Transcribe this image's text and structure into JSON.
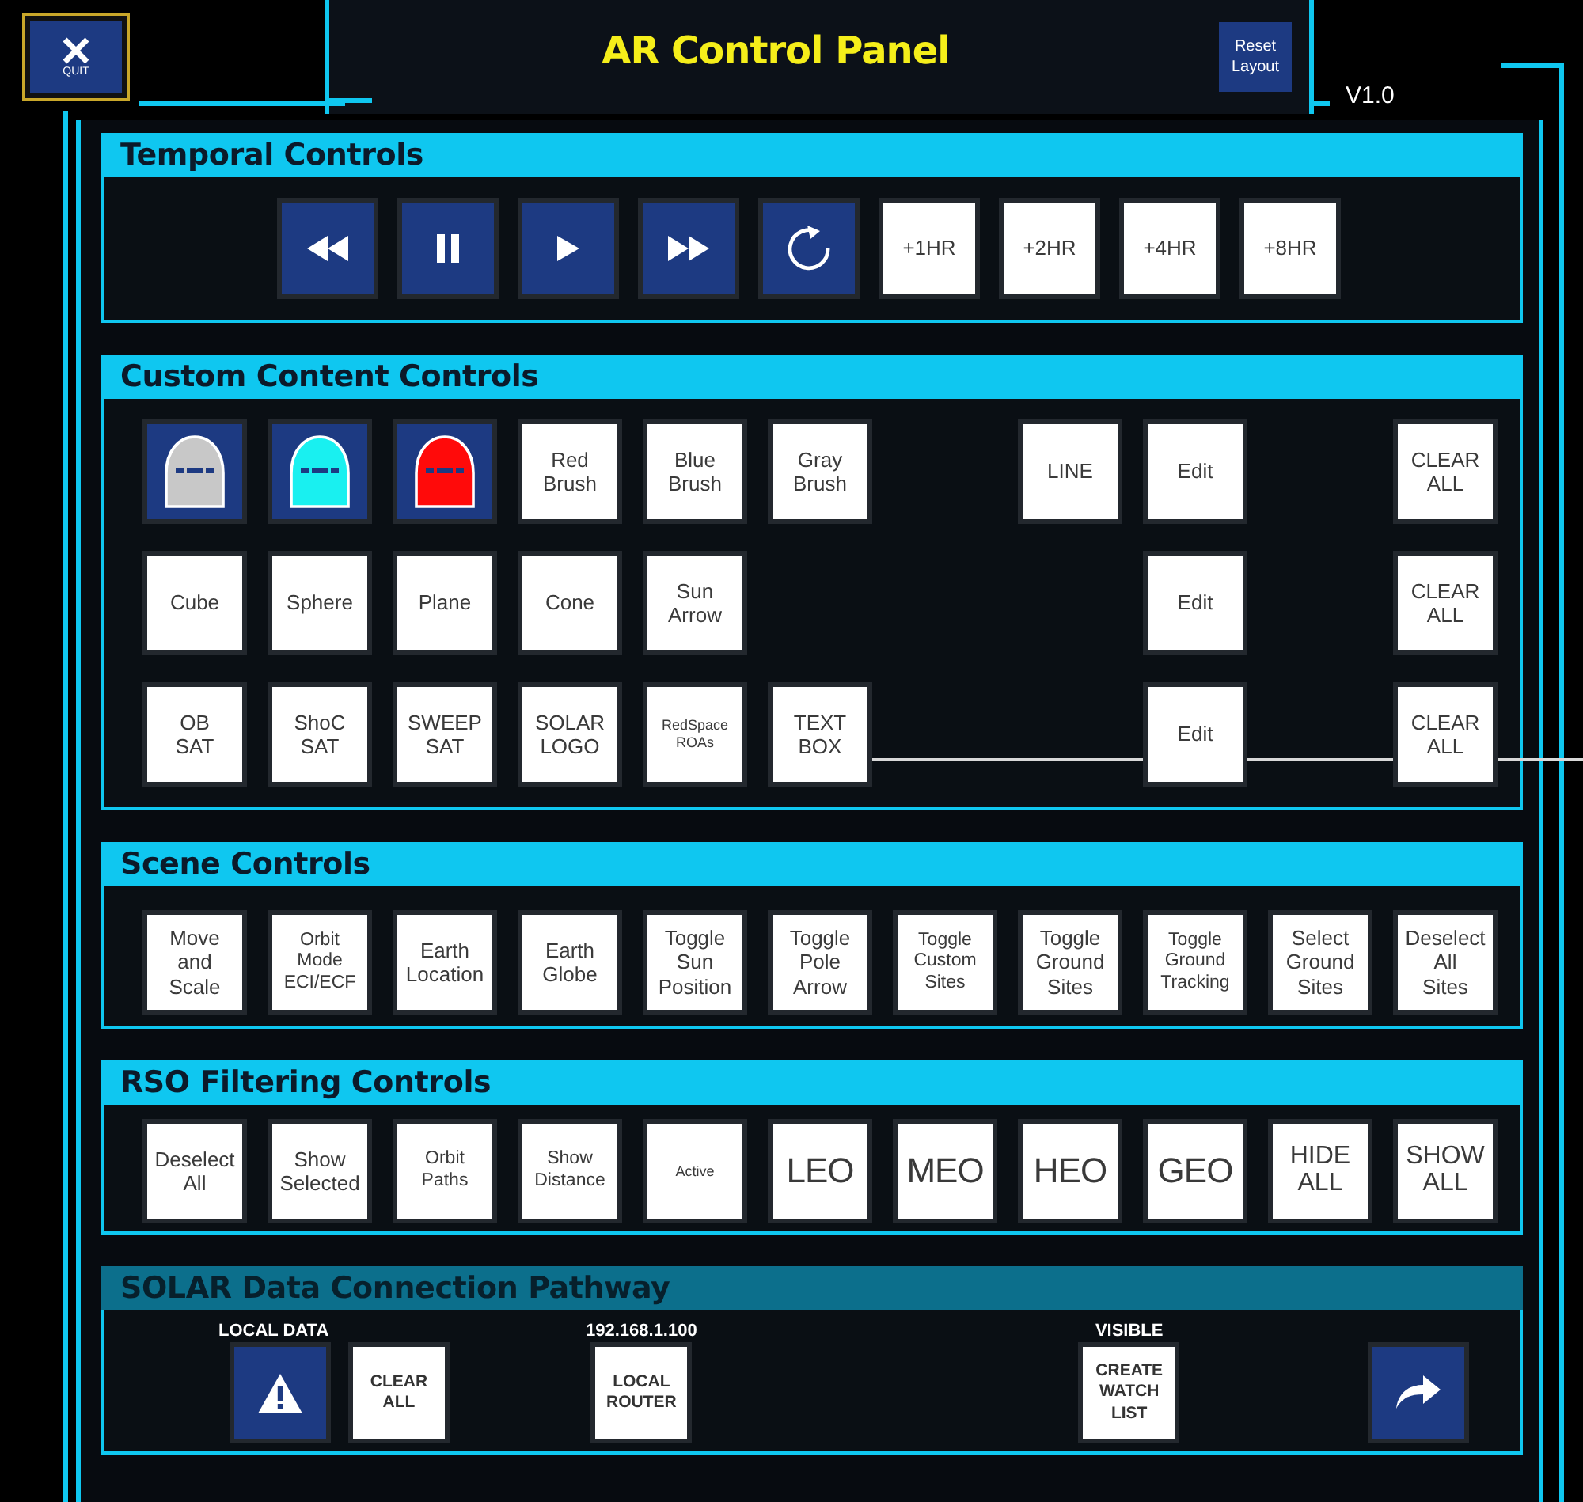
{
  "header": {
    "quit_label": "QUIT",
    "title": "AR Control Panel",
    "reset_label": "Reset\nLayout",
    "version": "V1.0"
  },
  "temporal": {
    "title": "Temporal Controls",
    "buttons": [
      {
        "kind": "rewind"
      },
      {
        "kind": "pause"
      },
      {
        "kind": "play"
      },
      {
        "kind": "forward"
      },
      {
        "kind": "replay"
      },
      {
        "kind": "text",
        "label": "+1HR"
      },
      {
        "kind": "text",
        "label": "+2HR"
      },
      {
        "kind": "text",
        "label": "+4HR"
      },
      {
        "kind": "text",
        "label": "+8HR"
      }
    ]
  },
  "custom_content": {
    "title": "Custom Content Controls",
    "rows": [
      {
        "items": [
          {
            "kind": "brush",
            "color": "#c8c8c8"
          },
          {
            "kind": "brush",
            "color": "#19f0f0"
          },
          {
            "kind": "brush",
            "color": "#ff0a0a"
          },
          {
            "kind": "text",
            "label": "Red\nBrush"
          },
          {
            "kind": "text",
            "label": "Blue\nBrush"
          },
          {
            "kind": "text",
            "label": "Gray\nBrush"
          }
        ],
        "line": "LINE",
        "edit": "Edit",
        "clear": "CLEAR\nALL"
      },
      {
        "items": [
          {
            "kind": "text",
            "label": "Cube"
          },
          {
            "kind": "text",
            "label": "Sphere"
          },
          {
            "kind": "text",
            "label": "Plane"
          },
          {
            "kind": "text",
            "label": "Cone"
          },
          {
            "kind": "text",
            "label": "Sun\nArrow"
          }
        ],
        "edit": "Edit",
        "clear": "CLEAR\nALL"
      },
      {
        "items": [
          {
            "kind": "text",
            "label": "OB\nSAT"
          },
          {
            "kind": "text",
            "label": "ShoC\nSAT"
          },
          {
            "kind": "text",
            "label": "SWEEP\nSAT"
          },
          {
            "kind": "text",
            "label": "SOLAR\nLOGO"
          },
          {
            "kind": "tiny",
            "label": "RedSpace\nROAs"
          },
          {
            "kind": "text",
            "label": "TEXT\nBOX"
          }
        ],
        "edit": "Edit",
        "clear": "CLEAR\nALL"
      }
    ]
  },
  "scene": {
    "title": "Scene Controls",
    "buttons": [
      {
        "kind": "text",
        "label": "Move\nand\nScale"
      },
      {
        "kind": "small",
        "label": "Orbit\nMode\nECI/ECF"
      },
      {
        "kind": "text",
        "label": "Earth\nLocation"
      },
      {
        "kind": "text",
        "label": "Earth\nGlobe"
      },
      {
        "kind": "text",
        "label": "Toggle\nSun\nPosition"
      },
      {
        "kind": "text",
        "label": "Toggle\nPole\nArrow"
      },
      {
        "kind": "small",
        "label": "Toggle\nCustom\nSites"
      },
      {
        "kind": "text",
        "label": "Toggle\nGround\nSites"
      },
      {
        "kind": "small",
        "label": "Toggle\nGround\nTracking"
      },
      {
        "kind": "text",
        "label": "Select\nGround\nSites"
      },
      {
        "kind": "text",
        "label": "Deselect\nAll\nSites"
      }
    ]
  },
  "rso_filtering": {
    "title": "RSO Filtering Controls",
    "buttons": [
      {
        "kind": "text",
        "label": "Deselect\nAll"
      },
      {
        "kind": "text",
        "label": "Show\nSelected"
      },
      {
        "kind": "small",
        "label": "Orbit\nPaths"
      },
      {
        "kind": "small",
        "label": "Show\nDistance"
      },
      {
        "kind": "tiny",
        "label": "Active"
      },
      {
        "kind": "big",
        "label": "LEO"
      },
      {
        "kind": "big",
        "label": "MEO"
      },
      {
        "kind": "big",
        "label": "HEO"
      },
      {
        "kind": "big",
        "label": "GEO"
      },
      {
        "kind": "medium",
        "label": "HIDE\nALL"
      },
      {
        "kind": "medium",
        "label": "SHOW\nALL"
      }
    ]
  },
  "solar_pathway": {
    "title": "SOLAR Data Connection Pathway",
    "groups": [
      {
        "caption": "LOCAL DATA",
        "buttons": [
          {
            "kind": "warning"
          },
          {
            "kind": "bold",
            "label": "CLEAR\nALL"
          }
        ]
      },
      {
        "caption": "192.168.1.100",
        "buttons": [
          {
            "kind": "bold",
            "label": "LOCAL\nROUTER"
          }
        ]
      },
      {
        "caption": "VISIBLE",
        "buttons": [
          {
            "kind": "bold",
            "label": "CREATE\nWATCH\nLIST"
          }
        ]
      },
      {
        "buttons": [
          {
            "kind": "share"
          }
        ]
      }
    ]
  }
}
